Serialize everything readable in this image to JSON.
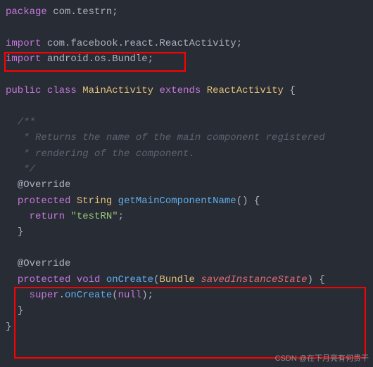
{
  "code": {
    "l1": {
      "kw": "package",
      "p1": " com",
      "p2": "testrn",
      "semi": ";"
    },
    "l3": {
      "kw": "import",
      "p1": " com",
      "p2": "facebook",
      "p3": "react",
      "p4": "ReactActivity",
      "semi": ";"
    },
    "l4": {
      "kw": "import",
      "p1": " android",
      "p2": "os",
      "p3": "Bundle",
      "semi": ";"
    },
    "l6": {
      "kw1": "public",
      "kw2": "class",
      "cls": "MainActivity",
      "kw3": "extends",
      "parent": "ReactActivity",
      "brace": " {"
    },
    "l8": {
      "txt": "  /**"
    },
    "l9": {
      "txt": "   * Returns the name of the main component registered"
    },
    "l10": {
      "txt": "   * rendering of the component."
    },
    "l11": {
      "txt": "   */"
    },
    "l12": {
      "ann": "@Override"
    },
    "l13": {
      "kw1": "protected",
      "type": "String",
      "method": "getMainComponentName",
      "paren": "()",
      "brace": " {"
    },
    "l14": {
      "kw": "return",
      "str": "\"testRN\"",
      "semi": ";"
    },
    "l15": {
      "brace": "}"
    },
    "l17": {
      "ann": "@Override"
    },
    "l18": {
      "kw1": "protected",
      "kw2": "void",
      "method": "onCreate",
      "lp": "(",
      "ptype": "Bundle",
      "pname": "savedInstanceState",
      "rp": ")",
      "brace": " {"
    },
    "l19": {
      "kw1": "super",
      "method": "onCreate",
      "lp": "(",
      "arg": "null",
      "rp": ")",
      "semi": ";"
    },
    "l20": {
      "brace": "}"
    },
    "l21": {
      "brace": "}"
    }
  },
  "dots": ".",
  "space": " ",
  "indent2": "  ",
  "indent4": "    ",
  "watermark": "CSDN @在下月亮有何贵干"
}
